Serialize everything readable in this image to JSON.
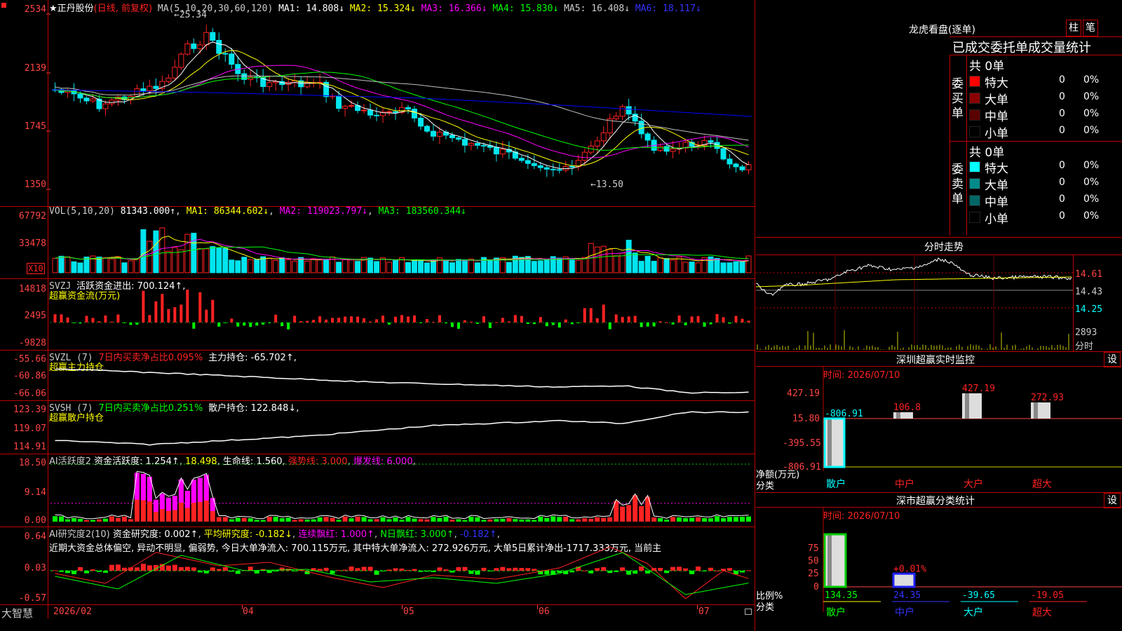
{
  "app": {
    "logo": "大智慧"
  },
  "main": {
    "title": "★正丹股份",
    "subtitle": "(日线, 前复权)",
    "ma_text": "MA(5,10,20,30,60,120)",
    "ma1": "MA1: 14.808↓",
    "ma2": "MA2: 15.324↓",
    "ma3": "MA3: 16.366↓",
    "ma4": "MA4: 15.830↓",
    "ma5": "MA5: 16.408↓",
    "ma6": "MA6: 18.117↓",
    "yticks": [
      "2534",
      "2139",
      "1745",
      "1350"
    ],
    "high_mark": "25.34",
    "low_mark": "13.50",
    "colors": {
      "up": "#ff2020",
      "down": "#00e5ee",
      "ma1": "#ffffff",
      "ma2": "#ffff00",
      "ma3": "#ff00ff",
      "ma4": "#00ff00",
      "ma5": "#c0c0c0",
      "ma6": "#0000ff"
    }
  },
  "vol": {
    "header": "VOL(5,10,20)",
    "val": "81343.000↑",
    "ma1": "MA1: 86344.602↓",
    "ma2": "MA2: 119023.797↓",
    "ma3": "MA3: 183560.344↓",
    "yticks": [
      "67792",
      "33478",
      "X10"
    ]
  },
  "svzj": {
    "header": "SVZJ",
    "val": "活跃资金进出: 700.124↑,",
    "sub": "超赢资金流(万元)",
    "yticks": [
      "14818",
      "2495",
      "-9828"
    ]
  },
  "svzl": {
    "header": "SVZL (7)",
    "t1": "7日内买卖净占比0.095%",
    "t2": "主力持仓: -65.702↑,",
    "sub": "超赢主力持仓",
    "yticks": [
      "-55.66",
      "-60.86",
      "-66.06"
    ]
  },
  "svsh": {
    "header": "SVSH (7)",
    "t1": "7日内买卖净占比0.251%",
    "t2": "散户持仓: 122.848↓,",
    "sub": "超赢散户持仓",
    "yticks": [
      "123.39",
      "119.07",
      "114.91"
    ]
  },
  "ai2": {
    "header": "AI活跃度2",
    "t1": "资金活跃度: 1.254↑",
    "t2": "18.498",
    "t3": "生命线: 1.560",
    "t4": "强势线: 3.000",
    "t5": "爆发线: 6.000",
    "yticks": [
      "18.50",
      "9.14",
      "0.00"
    ]
  },
  "ai3": {
    "header": "AI研究度2(10)",
    "t1": "资金研究度: 0.002↑",
    "t2": "平均研究度: -0.182↓",
    "t3": "连续飘红: 1.000↑",
    "t4": "N日飘红: 3.000↑",
    "t5": "-0.182↑",
    "desc": "近期大资金总体偏空, 异动不明显, 偏弱势, 今日大单净流入: 700.115万元, 其中特大单净流入: 272.926万元, 大单5日累计净出-1717.333万元, 当前主",
    "yticks": [
      "0.64",
      "0.03",
      "-0.57"
    ]
  },
  "xaxis": [
    "2026/02",
    "04",
    "05",
    "06",
    "07"
  ],
  "longhu": {
    "title": "龙虎看盘(逐单)",
    "btn1": "柱",
    "btn2": "笔",
    "header": "已成交委托单成交量统计",
    "buy_label": "委买单",
    "sell_label": "委卖单",
    "total": "共 0单",
    "rows": [
      {
        "name": "特大",
        "n": "0",
        "p": "0%"
      },
      {
        "name": "大单",
        "n": "0",
        "p": "0%"
      },
      {
        "name": "中单",
        "n": "0",
        "p": "0%"
      },
      {
        "name": "小单",
        "n": "0",
        "p": "0%"
      }
    ],
    "buy_colors": [
      "#ff0000",
      "#8b0000",
      "#5a0000",
      "#000000"
    ],
    "sell_colors": [
      "#00ffff",
      "#008b8b",
      "#006666",
      "#000000"
    ]
  },
  "fenshi": {
    "title": "分时走势",
    "yticks": [
      "14.61",
      "14.43",
      "14.25",
      "2893",
      "分时"
    ]
  },
  "sz_monitor": {
    "title": "深圳超赢实时监控",
    "gear": "设",
    "time": "时间: 2026/07/10",
    "yticks": [
      "427.19",
      "15.80",
      "-395.55",
      "-806.91"
    ],
    "ylab1": "净额(万元)",
    "ylab2": "分类",
    "cats": [
      "散户",
      "中户",
      "大户",
      "超大"
    ],
    "values": [
      -806.91,
      106.8,
      427.19,
      272.93
    ],
    "labels": [
      "-806.91",
      "106.8",
      "427.19",
      "272.93"
    ]
  },
  "sz_class": {
    "title": "深市超赢分类统计",
    "gear": "设",
    "time": "时间: 2026/07/10",
    "yticks": [
      "75",
      "50",
      "25",
      "0"
    ],
    "ylab1": "比例%",
    "ylab2": "分类",
    "cats": [
      "散户",
      "中户",
      "大户",
      "超大"
    ],
    "bottom_vals": [
      "134.35",
      "24.35",
      "-39.65",
      "-19.05"
    ],
    "mid_label": "+0.01%",
    "bars": [
      100,
      25
    ]
  }
}
